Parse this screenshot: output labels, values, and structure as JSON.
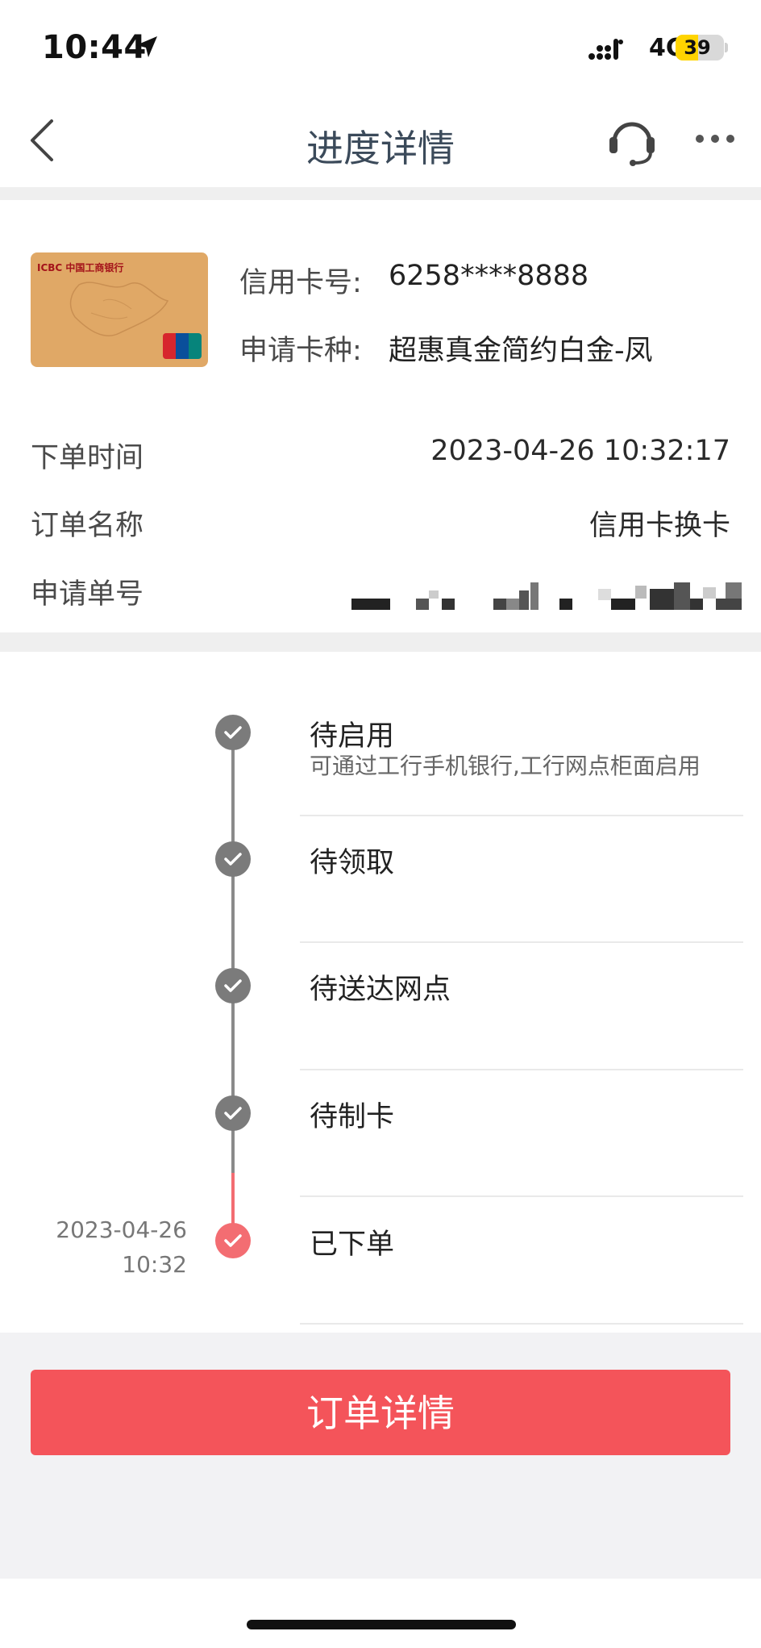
{
  "status_bar": {
    "time": "10:44",
    "network": "4G",
    "battery": "39",
    "battery_level_percent": 39,
    "icons": [
      "location-arrow-icon",
      "signal-icon",
      "battery-icon"
    ]
  },
  "nav": {
    "title": "进度详情",
    "icons": [
      "back-chevron-icon",
      "headset-icon",
      "more-icon"
    ]
  },
  "card": {
    "image_text": "ICBC 中国工商银行",
    "number_label": "信用卡号:",
    "number_value": "6258****8888",
    "type_label": "申请卡种:",
    "type_value": "超惠真金简约白金-凤"
  },
  "details": {
    "order_time_label": "下单时间",
    "order_time_value": "2023-04-26 10:32:17",
    "order_name_label": "订单名称",
    "order_name_value": "信用卡换卡",
    "application_no_label": "申请单号"
  },
  "timeline": [
    {
      "title": "待启用",
      "desc": "可通过工行手机银行,工行网点柜面启用",
      "status": "gray"
    },
    {
      "title": "待领取",
      "status": "gray"
    },
    {
      "title": "待送达网点",
      "status": "gray"
    },
    {
      "title": "待制卡",
      "status": "gray"
    },
    {
      "title": "已下单",
      "date": "2023-04-26",
      "time": "10:32",
      "status": "red"
    }
  ],
  "button": {
    "label": "订单详情"
  },
  "colors": {
    "accent": "#f4545a",
    "timeline_active": "#f36d72",
    "timeline_done": "#7b7b7b",
    "nav_title": "#3b4a5a"
  }
}
